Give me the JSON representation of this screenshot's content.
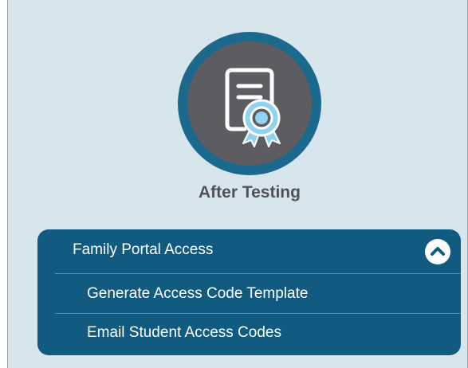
{
  "section": {
    "title": "After Testing",
    "icon": "certificate-icon"
  },
  "accordion": {
    "header_label": "Family Portal Access",
    "toggle_icon": "chevron-up-icon",
    "expanded": true,
    "items": [
      {
        "label": "Generate Access Code Template"
      },
      {
        "label": "Email Student Access Codes"
      }
    ]
  },
  "colors": {
    "panel_background": "#d6e6ec",
    "accent_blue": "#1b6a8d",
    "accordion_background": "#115a80",
    "icon_gray": "#5d5d61",
    "icon_highlight": "#8fd3ef"
  }
}
